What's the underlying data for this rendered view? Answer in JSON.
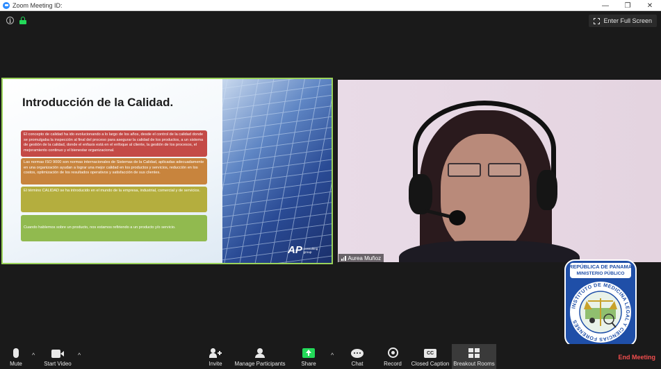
{
  "window": {
    "title": "Zoom Meeting ID:",
    "minimize": "—",
    "restore": "❐",
    "close": "✕"
  },
  "header": {
    "info_glyph": "i",
    "fullscreen_label": "Enter Full Screen"
  },
  "slide": {
    "title": "Introducción de la Calidad.",
    "boxes": [
      "El concepto de calidad ha ido evolucionando a lo largo de los años, desde el control de la calidad donde se promulgaba la inspección al final del proceso para asegurar la calidad de los productos, a un sistema de gestión de la calidad, donde el enfasis está en el enfoque al cliente, la gestión de los procesos, el mejoramiento continuo y el bienestar organizacional.",
      "Las normas ISO 9000 son normas internacionales de Sistemas de la Calidad, aplicadas adecuadamente en una organización ayudan a lograr una mejor calidad en los productos y servicios, reducción en los costos, optimización de los resultados operativos y satisfacción de sus clientes.",
      "El término CALIDAD se ha introducido en el mundo de la empresa, industrial, comercial y de servicios.",
      "Cuando hablemos sobre un producto, nos estamos refiriendo a un producto y/o servicio."
    ],
    "logo_mark": "AP",
    "logo_sub1": "consulting",
    "logo_sub2": "group"
  },
  "participant": {
    "name": "Aurea Muñoz"
  },
  "seal": {
    "line1": "REPÚBLICA DE PANAMÁ",
    "line2": "MINISTERIO PÚBLICO",
    "ring_text": "INSTITUTO DE MEDICINA LEGAL Y CIENCIAS FORENSES"
  },
  "toolbar": {
    "mute": "Mute",
    "start_video": "Start Video",
    "invite": "Invite",
    "manage_participants": "Manage Participants",
    "share": "Share",
    "chat": "Chat",
    "record": "Record",
    "closed_caption": "Closed Caption",
    "cc_glyph": "CC",
    "breakout_rooms": "Breakout Rooms",
    "end_meeting": "End Meeting",
    "caret": "^"
  },
  "colors": {
    "accent_green": "#9bd35a",
    "lock_green": "#23d959",
    "end_red": "#f24e4e",
    "share_green": "#23d959"
  }
}
